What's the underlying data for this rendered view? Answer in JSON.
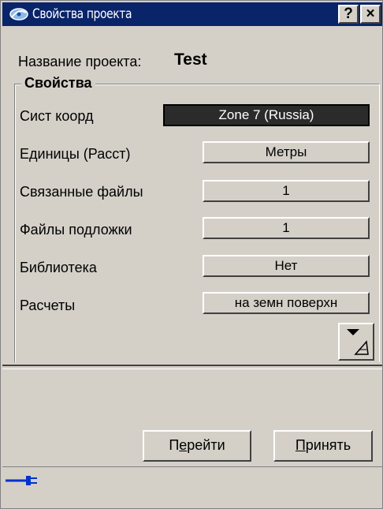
{
  "window": {
    "title": "Свойства проекта",
    "help_label": "?",
    "close_label": "×",
    "title_icon": "satellite-dish-icon"
  },
  "project": {
    "name_label": "Название проекта:",
    "name_value": "Test"
  },
  "properties": {
    "group_title": "Свойства",
    "rows": [
      {
        "label": "Сист коорд",
        "value": "Zone  7 (Russia)"
      },
      {
        "label": "Единицы (Расст)",
        "value": "Метры"
      },
      {
        "label": "Связанные файлы",
        "value": "1"
      },
      {
        "label": "Файлы подложки",
        "value": "1"
      },
      {
        "label": "Библиотека",
        "value": "Нет"
      },
      {
        "label": "Расчеты",
        "value": "на земн поверхн"
      }
    ],
    "expand_icon": "triangle-down-icon"
  },
  "buttons": {
    "go_before": "П",
    "go_mnemonic": "е",
    "go_after": "рейти",
    "accept_mnemonic": "П",
    "accept_after": "ринять"
  },
  "status": {
    "connection_icon": "plug-connected-icon",
    "accent_color": "#0033cc"
  }
}
